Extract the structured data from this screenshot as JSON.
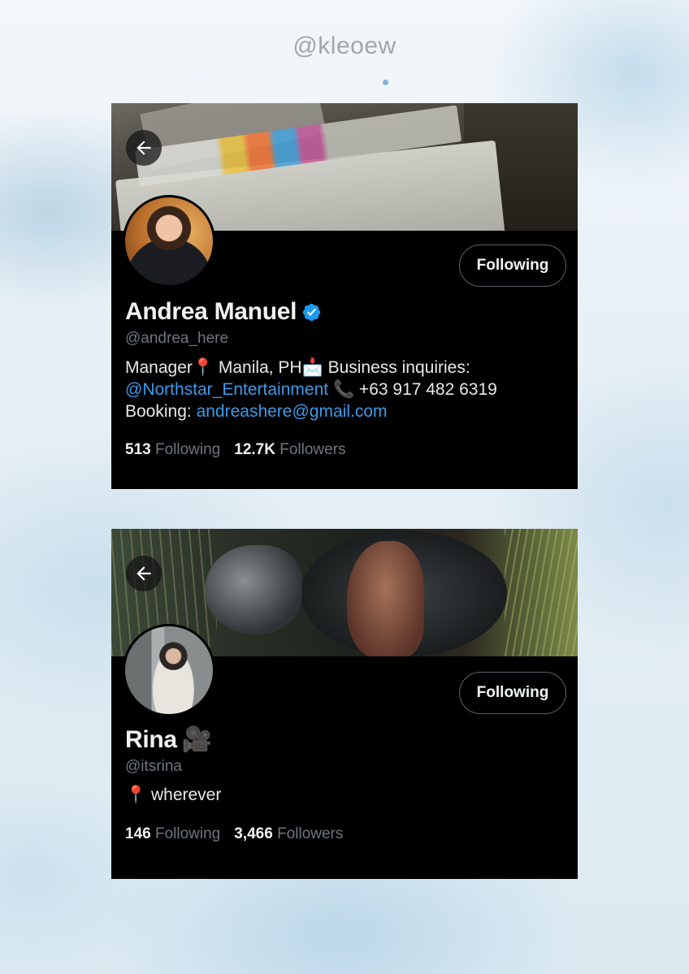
{
  "watermark": "@kleoew",
  "profiles": [
    {
      "name": "Andrea Manuel",
      "verified": true,
      "handle": "@andrea_here",
      "follow_button": "Following",
      "bio": {
        "part1": "Manager",
        "pin_icon": "📍",
        "part2": " Manila, PH",
        "mail_icon": "📩",
        "part3": " Business inquiries: ",
        "mention": "@Northstar_Entertainment",
        "phone_icon": "📞",
        "part4": " +63 917 482 6319",
        "part5": "Booking: ",
        "email": "andreashere@gmail.com"
      },
      "following_count": "513",
      "following_label": "Following",
      "followers_count": "12.7K",
      "followers_label": "Followers"
    },
    {
      "name": "Rina",
      "name_icon": "🎥",
      "handle": "@itsrina",
      "follow_button": "Following",
      "bio": {
        "pin_icon": "📍",
        "text": " wherever"
      },
      "following_count": "146",
      "following_label": "Following",
      "followers_count": "3,466",
      "followers_label": "Followers"
    }
  ],
  "colors": {
    "card_bg": "#000000",
    "link": "#3b9ae8",
    "muted": "#6e767d",
    "verified": "#1d9bf0"
  }
}
